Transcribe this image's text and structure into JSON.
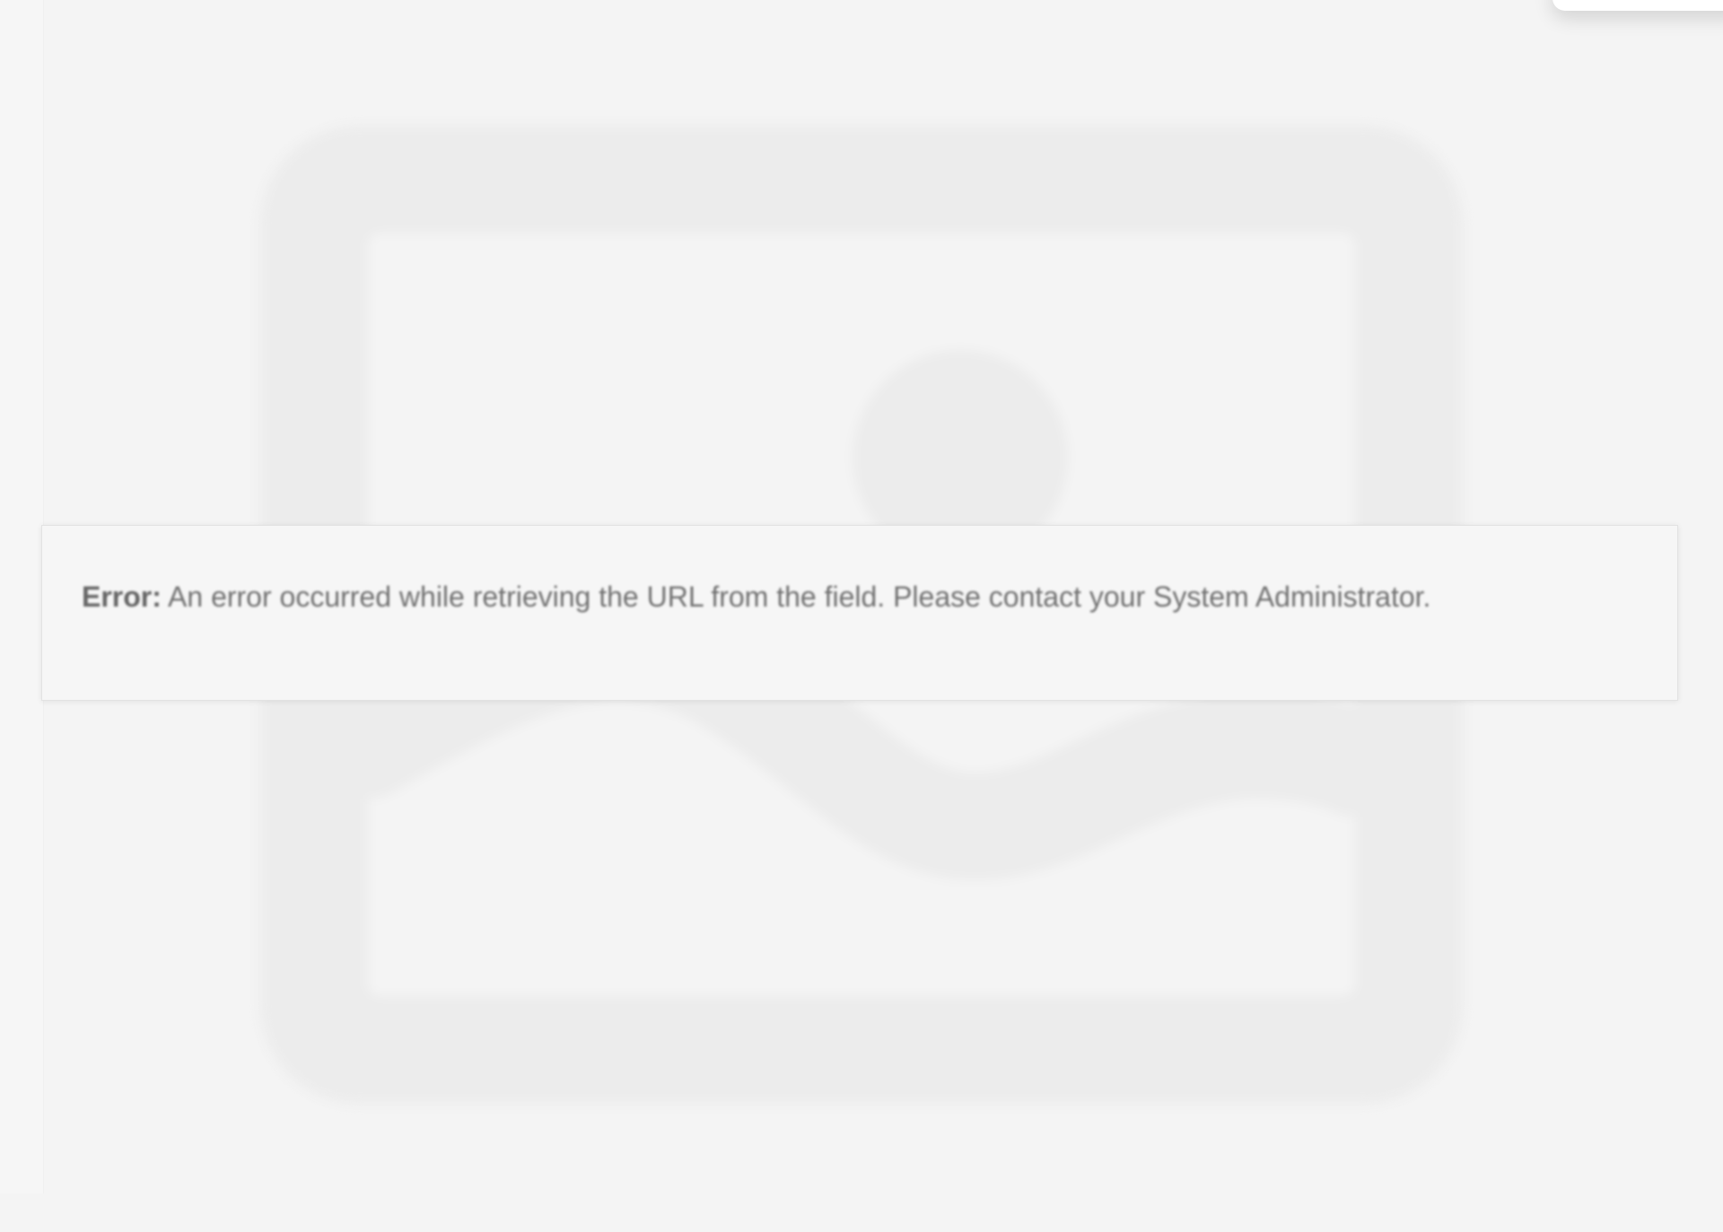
{
  "error_banner": {
    "label": "Error:",
    "message": "An error occurred while retrieving the URL from the field. Please contact your System Administrator."
  },
  "placeholder": {
    "icon": "image-placeholder-icon"
  },
  "colors": {
    "background": "#f4f4f4",
    "banner_background": "#f6f6f6",
    "banner_border": "#e2e2e2",
    "text": "#707070",
    "placeholder_shape": "#ececec"
  }
}
